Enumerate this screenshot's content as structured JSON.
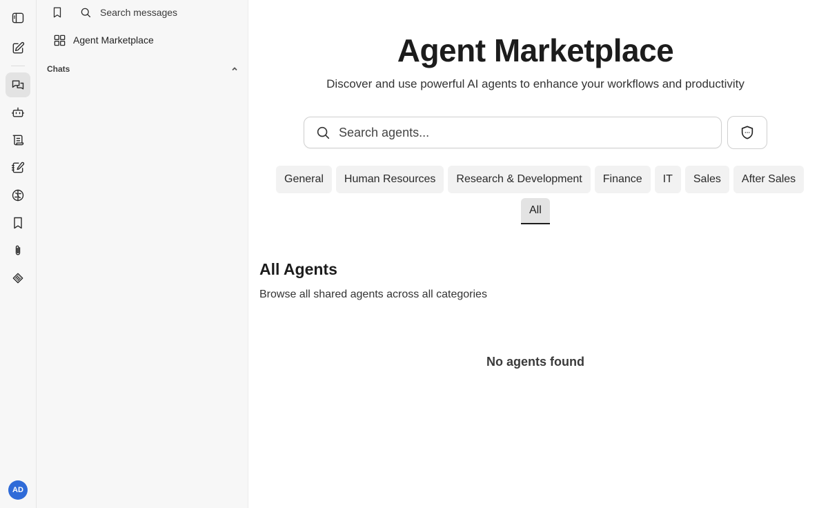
{
  "rail": {
    "items": [
      {
        "icon": "sidebar-toggle-icon"
      },
      {
        "icon": "new-chat-icon"
      },
      {
        "icon": "chats-icon",
        "active": true
      },
      {
        "icon": "bot-icon"
      },
      {
        "icon": "scroll-icon"
      },
      {
        "icon": "notebook-pen-icon"
      },
      {
        "icon": "brain-icon"
      },
      {
        "icon": "bookmark-icon"
      },
      {
        "icon": "paperclip-icon"
      },
      {
        "icon": "pen-tool-icon"
      }
    ],
    "avatar": "AD"
  },
  "panel": {
    "search_label": "Search messages",
    "marketplace_label": "Agent Marketplace",
    "chats_label": "Chats"
  },
  "main": {
    "title": "Agent Marketplace",
    "subtitle": "Discover and use powerful AI agents to enhance your workflows and productivity",
    "search_placeholder": "Search agents...",
    "categories": [
      "General",
      "Human Resources",
      "Research & Development",
      "Finance",
      "IT",
      "Sales",
      "After Sales"
    ],
    "active_category": "All",
    "section_title": "All Agents",
    "section_subtitle": "Browse all shared agents across all categories",
    "empty_message": "No agents found"
  },
  "colors": {
    "avatar": "#2f6bd8",
    "active_rail": "#e3e3e3",
    "tab_bg": "#f2f2f2"
  }
}
